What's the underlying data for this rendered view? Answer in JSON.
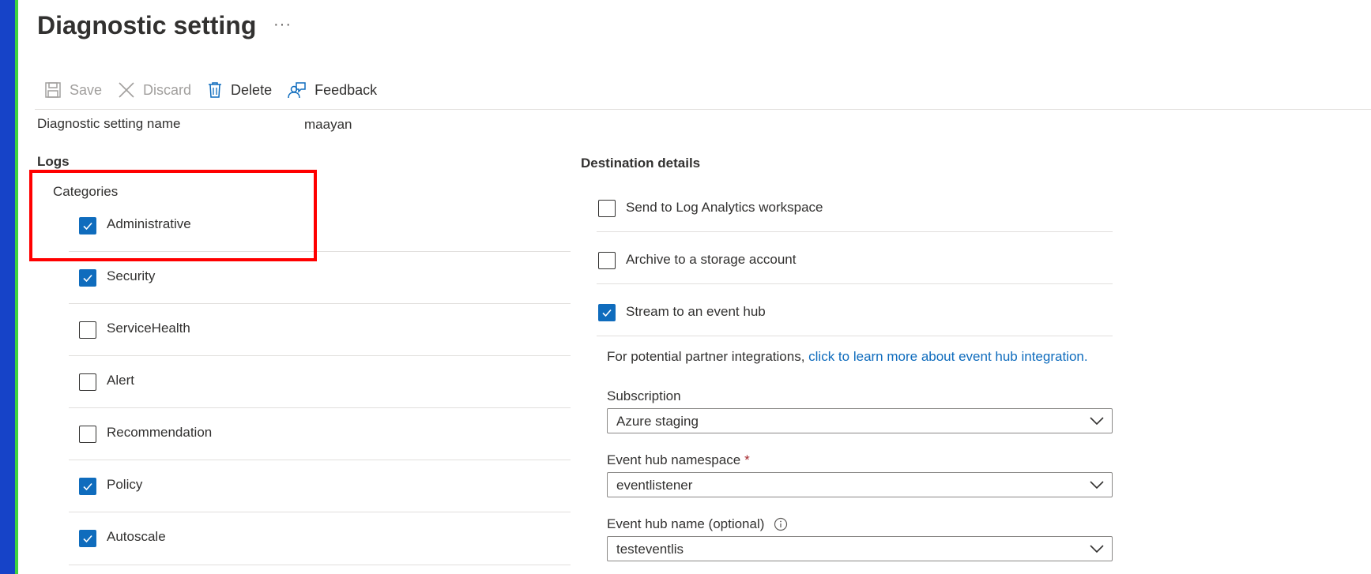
{
  "page": {
    "title": "Diagnostic setting",
    "more_glyph": "···"
  },
  "toolbar": {
    "save": {
      "label": "Save",
      "icon": "save-icon",
      "enabled": false
    },
    "discard": {
      "label": "Discard",
      "icon": "close-icon",
      "enabled": false
    },
    "delete": {
      "label": "Delete",
      "icon": "trash-icon",
      "enabled": true
    },
    "feedback": {
      "label": "Feedback",
      "icon": "feedback-icon",
      "enabled": true
    }
  },
  "setting": {
    "name_label": "Diagnostic setting name",
    "name_value": "maayan"
  },
  "logs": {
    "heading": "Logs",
    "categories_label": "Categories",
    "categories": [
      {
        "label": "Administrative",
        "checked": true
      },
      {
        "label": "Security",
        "checked": true
      },
      {
        "label": "ServiceHealth",
        "checked": false
      },
      {
        "label": "Alert",
        "checked": false
      },
      {
        "label": "Recommendation",
        "checked": false
      },
      {
        "label": "Policy",
        "checked": true
      },
      {
        "label": "Autoscale",
        "checked": true
      }
    ]
  },
  "destination": {
    "heading": "Destination details",
    "options": [
      {
        "label": "Send to Log Analytics workspace",
        "checked": false
      },
      {
        "label": "Archive to a storage account",
        "checked": false
      },
      {
        "label": "Stream to an event hub",
        "checked": true
      }
    ],
    "partner_text": "For potential partner integrations, ",
    "partner_link": "click to learn more about event hub integration.",
    "subscription": {
      "label": "Subscription",
      "value": "Azure staging"
    },
    "namespace": {
      "label": "Event hub namespace",
      "required_mark": "*",
      "value": "eventlistener"
    },
    "hub_name": {
      "label": "Event hub name (optional)",
      "value": "testeventlis"
    }
  },
  "colors": {
    "accent": "#0f6cbd",
    "highlight": "#ff0000",
    "left_edge_blue": "#1643c8",
    "left_edge_green": "#3fd23f",
    "required": "#a4262c"
  }
}
